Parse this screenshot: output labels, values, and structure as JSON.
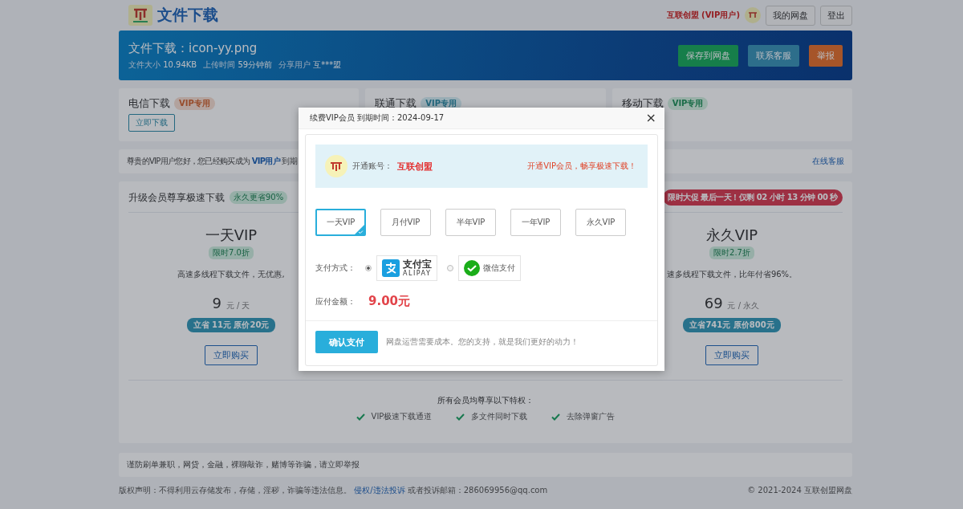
{
  "header": {
    "title": "文件下载",
    "user": "互联创盟 (VIP用户)",
    "buttons": [
      "我的网盘",
      "登出"
    ]
  },
  "banner": {
    "title": "文件下载：icon-yy.png",
    "meta": [
      {
        "label": "文件大小",
        "value": "10.94KB"
      },
      {
        "label": "上传时间",
        "value": "59分钟前"
      },
      {
        "label": "分享用户",
        "value": "互***盟"
      }
    ],
    "buttons": [
      {
        "label": "保存到网盘",
        "kind": "save"
      },
      {
        "label": "联系客服",
        "kind": "contact"
      },
      {
        "label": "举报",
        "kind": "report"
      }
    ]
  },
  "download_cards": [
    {
      "title": "电信下载",
      "badge": "VIP专用",
      "kind": "telecom",
      "button": "立即下载"
    },
    {
      "title": "联通下载",
      "badge": "VIP专用",
      "kind": "unicom"
    },
    {
      "title": "移动下载",
      "badge": "VIP专用",
      "kind": "mobile"
    }
  ],
  "notice": {
    "text": "尊贵的VIP用户您好，您已经购买成为",
    "link": "VIP用户",
    "after": "到期",
    "service": "在线客服"
  },
  "pricing": {
    "title": "升级会员尊享极速下载",
    "badge": "永久更省90%",
    "promo": "限时大促 最后一天！仅剩 02 小时 13 分钟 00 秒",
    "plans": [
      {
        "name": "一天VIP",
        "discount": "限时7.0折",
        "desc": "高速多线程下载文件，无优惠,",
        "price": "9",
        "unit": "元 / 天",
        "saving": "立省 11元 原价20元",
        "button": "立即购买"
      },
      {
        "name": "永久VIP",
        "discount": "限时2.7折",
        "desc": "速多线程下载文件，比年付省96%。",
        "price": "69",
        "unit": "元 / 永久",
        "saving": "立省741元 原价800元",
        "button": "立即购买"
      }
    ],
    "perks_title": "所有会员均尊享以下特权：",
    "perks": [
      "VIP极速下载通道",
      "多文件同时下载",
      "去除弹窗广告"
    ]
  },
  "warning": "谨防刷单兼职，网贷，金融，裸聊敲诈，赌博等诈骗，请立即举报",
  "footer": {
    "text": "版权声明：不得利用云存储发布，存储，淫秽，诈骗等违法信息。",
    "link": "侵权/违法投诉",
    "after": "或者投诉邮箱：286069956@qq.com",
    "copyright": "© 2021-2024 互联创盟网盘"
  },
  "modal": {
    "title": "续费VIP会员 到期时间：2024-09-17",
    "close": "×",
    "account_label": "开通账号：",
    "account": "互联创盟",
    "slogan": "开通VIP会员，畅享极速下载！",
    "plans": [
      {
        "label": "一天VIP",
        "selected": true
      },
      {
        "label": "月付VIP",
        "selected": false
      },
      {
        "label": "半年VIP",
        "selected": false
      },
      {
        "label": "一年VIP",
        "selected": false
      },
      {
        "label": "永久VIP",
        "selected": false
      }
    ],
    "pay_label": "支付方式：",
    "payment_methods": [
      {
        "kind": "alipay",
        "label": "支付宝",
        "sub": "ALIPAY",
        "selected": true
      },
      {
        "kind": "wechat",
        "label": "微信支付",
        "selected": false
      }
    ],
    "amount_label": "应付金额：",
    "amount": "9.00元",
    "confirm": "确认支付",
    "note": "网盘运营需要成本。您的支持，就是我们更好的动力！"
  }
}
